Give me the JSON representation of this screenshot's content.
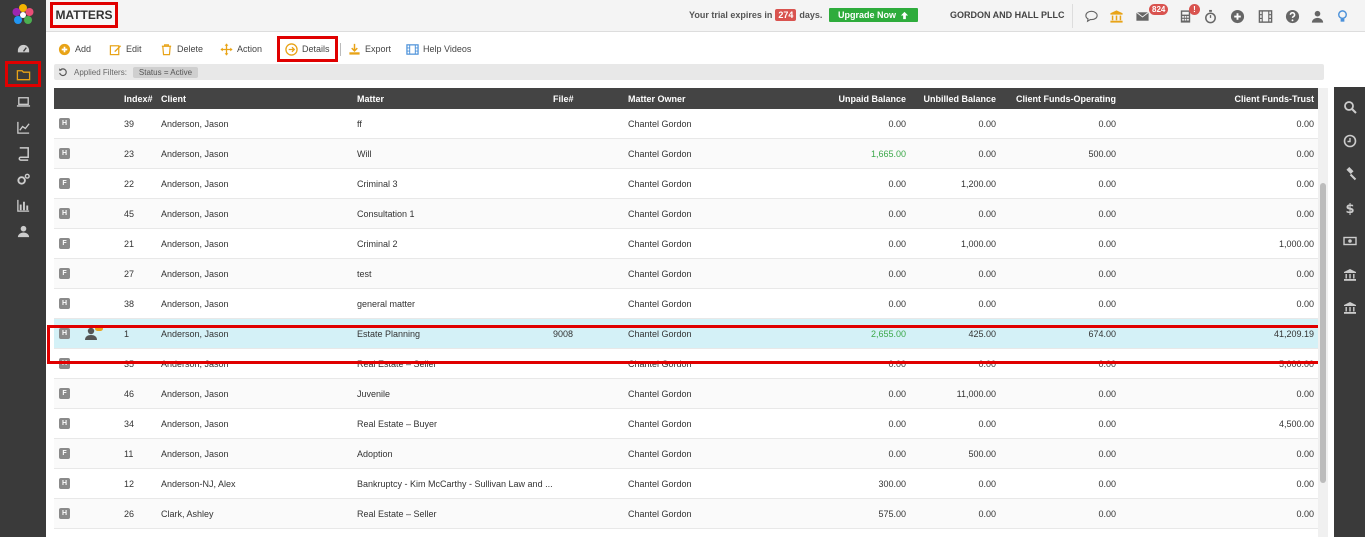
{
  "header": {
    "title": "MATTERS",
    "trial_prefix": "Your trial expires in",
    "trial_days": "274",
    "trial_suffix": "days.",
    "upgrade_label": "Upgrade Now",
    "firm_name": "GORDON AND HALL PLLC",
    "mail_count": "824",
    "alert_mark": "!"
  },
  "toolbar": {
    "add": "Add",
    "edit": "Edit",
    "delete": "Delete",
    "action": "Action",
    "details": "Details",
    "export": "Export",
    "help_videos": "Help Videos"
  },
  "filters": {
    "label": "Applied Filters:",
    "chip": "Status = Active"
  },
  "table": {
    "columns": {
      "index": "Index#",
      "client": "Client",
      "matter": "Matter",
      "file": "File#",
      "owner": "Matter Owner",
      "unpaid": "Unpaid Balance",
      "unbilled": "Unbilled Balance",
      "funds_operating": "Client Funds-Operating",
      "funds_trust": "Client Funds-Trust"
    },
    "rows": [
      {
        "badge": "H",
        "index": "39",
        "client": "Anderson, Jason",
        "matter": "ff",
        "file": "",
        "owner": "Chantel Gordon",
        "unpaid": "0.00",
        "unbilled": "0.00",
        "operating": "0.00",
        "trust": "0.00"
      },
      {
        "badge": "H",
        "index": "23",
        "client": "Anderson, Jason",
        "matter": "Will",
        "file": "",
        "owner": "Chantel Gordon",
        "unpaid": "1,665.00",
        "unbilled": "0.00",
        "operating": "500.00",
        "trust": "0.00"
      },
      {
        "badge": "F",
        "index": "22",
        "client": "Anderson, Jason",
        "matter": "Criminal 3",
        "file": "",
        "owner": "Chantel Gordon",
        "unpaid": "0.00",
        "unbilled": "1,200.00",
        "operating": "0.00",
        "trust": "0.00"
      },
      {
        "badge": "H",
        "index": "45",
        "client": "Anderson, Jason",
        "matter": "Consultation 1",
        "file": "",
        "owner": "Chantel Gordon",
        "unpaid": "0.00",
        "unbilled": "0.00",
        "operating": "0.00",
        "trust": "0.00"
      },
      {
        "badge": "F",
        "index": "21",
        "client": "Anderson, Jason",
        "matter": "Criminal 2",
        "file": "",
        "owner": "Chantel Gordon",
        "unpaid": "0.00",
        "unbilled": "1,000.00",
        "operating": "0.00",
        "trust": "1,000.00"
      },
      {
        "badge": "F",
        "index": "27",
        "client": "Anderson, Jason",
        "matter": "test",
        "file": "",
        "owner": "Chantel Gordon",
        "unpaid": "0.00",
        "unbilled": "0.00",
        "operating": "0.00",
        "trust": "0.00"
      },
      {
        "badge": "H",
        "index": "38",
        "client": "Anderson, Jason",
        "matter": "general matter",
        "file": "",
        "owner": "Chantel Gordon",
        "unpaid": "0.00",
        "unbilled": "0.00",
        "operating": "0.00",
        "trust": "0.00"
      },
      {
        "badge": "H",
        "index": "1",
        "client": "Anderson, Jason",
        "matter": "Estate Planning",
        "file": "9008",
        "owner": "Chantel Gordon",
        "unpaid": "2,655.00",
        "unbilled": "425.00",
        "operating": "674.00",
        "trust": "41,209.19"
      },
      {
        "badge": "H",
        "index": "35",
        "client": "Anderson, Jason",
        "matter": "Real Estate – Seller",
        "file": "",
        "owner": "Chantel Gordon",
        "unpaid": "0.00",
        "unbilled": "0.00",
        "operating": "0.00",
        "trust": "5,000.00"
      },
      {
        "badge": "F",
        "index": "46",
        "client": "Anderson, Jason",
        "matter": "Juvenile",
        "file": "",
        "owner": "Chantel Gordon",
        "unpaid": "0.00",
        "unbilled": "11,000.00",
        "operating": "0.00",
        "trust": "0.00"
      },
      {
        "badge": "H",
        "index": "34",
        "client": "Anderson, Jason",
        "matter": "Real Estate – Buyer",
        "file": "",
        "owner": "Chantel Gordon",
        "unpaid": "0.00",
        "unbilled": "0.00",
        "operating": "0.00",
        "trust": "4,500.00"
      },
      {
        "badge": "F",
        "index": "11",
        "client": "Anderson, Jason",
        "matter": "Adoption",
        "file": "",
        "owner": "Chantel Gordon",
        "unpaid": "0.00",
        "unbilled": "500.00",
        "operating": "0.00",
        "trust": "0.00"
      },
      {
        "badge": "H",
        "index": "12",
        "client": "Anderson-NJ, Alex",
        "matter": "Bankruptcy - Kim McCarthy - Sullivan Law and ...",
        "file": "",
        "owner": "Chantel Gordon",
        "unpaid": "300.00",
        "unbilled": "0.00",
        "operating": "0.00",
        "trust": "0.00"
      },
      {
        "badge": "H",
        "index": "26",
        "client": "Clark, Ashley",
        "matter": "Real Estate – Seller",
        "file": "",
        "owner": "Chantel Gordon",
        "unpaid": "575.00",
        "unbilled": "0.00",
        "operating": "0.00",
        "trust": "0.00"
      }
    ],
    "green_unpaid_rows": [
      1,
      7
    ],
    "selected_row": 7
  },
  "colors": {
    "sidebar_bg": "#3a3a3a",
    "header_row_bg": "#444444",
    "selected_row_bg": "#d4f1f7",
    "highlight_red": "#e00000",
    "upgrade_green": "#2eac3c",
    "toolbar_icon": "#e8a317",
    "help_icon": "#4a90d9"
  },
  "icons": {
    "left_nav": [
      "dashboard-icon",
      "folder-icon",
      "laptop-icon",
      "chart-icon",
      "book-icon",
      "gears-icon",
      "bar-chart-icon",
      "user-icon"
    ],
    "right_nav": [
      "search-icon",
      "clock-icon",
      "gavel-icon",
      "dollar-icon",
      "money-icon",
      "bank-icon",
      "bank-add-icon"
    ],
    "header": [
      "chat-icon",
      "bank-icon",
      "mail-icon",
      "calculator-icon",
      "stopwatch-icon",
      "plus-circle-icon",
      "film-icon",
      "help-icon",
      "user-icon",
      "lightbulb-icon"
    ]
  }
}
